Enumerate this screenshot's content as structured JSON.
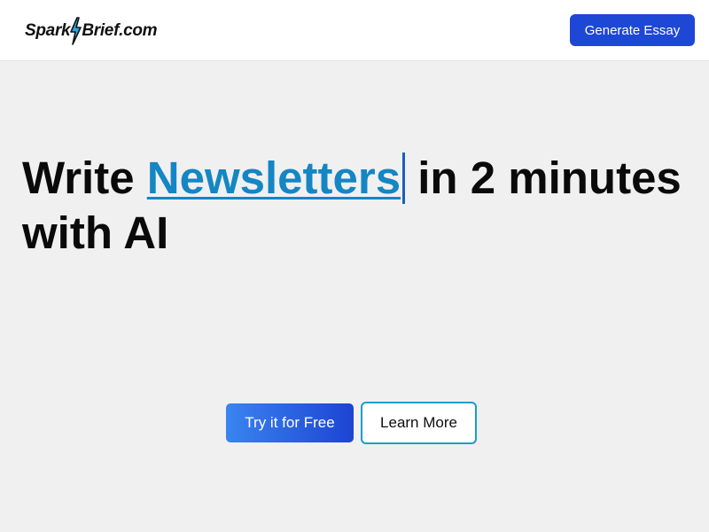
{
  "header": {
    "logo_left": "Spark",
    "logo_right": "Brief.com",
    "cta_label": "Generate Essay"
  },
  "hero": {
    "title_prefix": "Write ",
    "title_keyword": "Newsletters",
    "title_suffix": " in 2 minutes with AI"
  },
  "actions": {
    "primary_label": "Try it for Free",
    "secondary_label": "Learn More"
  },
  "icons": {
    "logo_mark": "lightning-bolt-icon"
  },
  "colors": {
    "background": "#f0f0f0",
    "header_cta": "#1f47d6",
    "keyword": "#1486c4",
    "primary_gradient_start": "#3a84f0",
    "primary_gradient_end": "#1d44d2",
    "secondary_border": "#16a0c8"
  }
}
